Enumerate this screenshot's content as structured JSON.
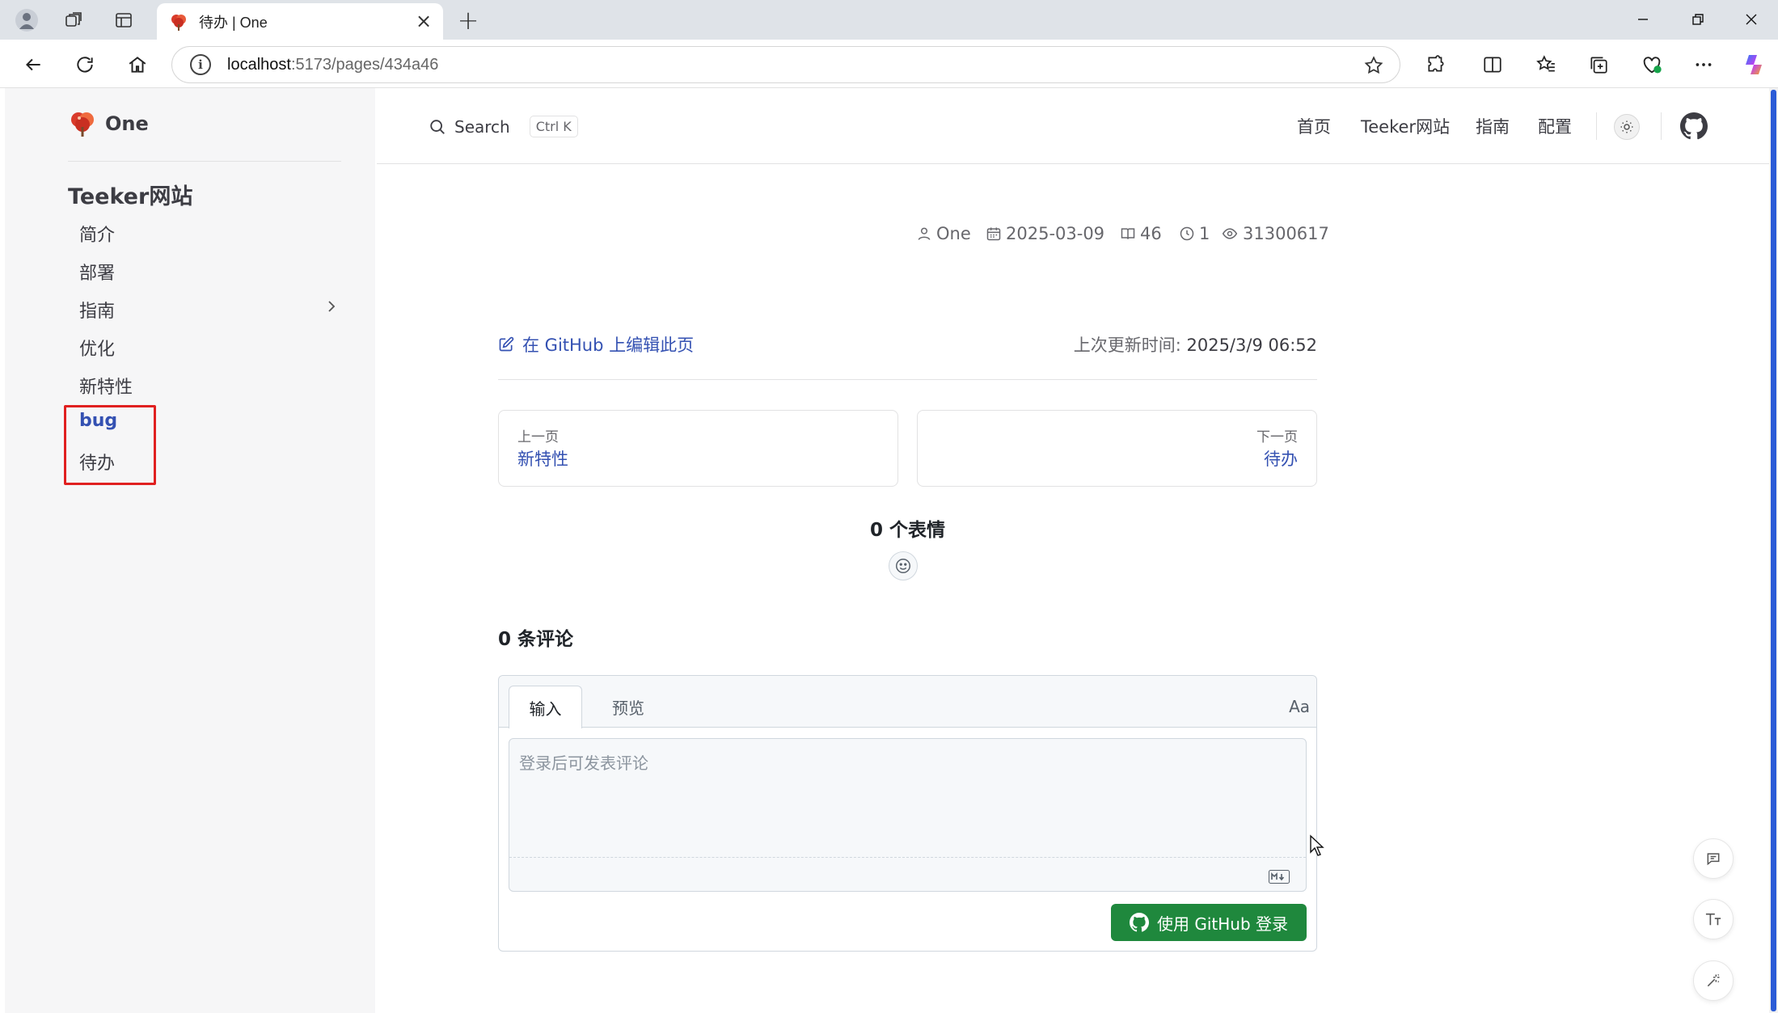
{
  "browser": {
    "tab_title": "待办 | One",
    "url_host": "localhost",
    "url_rest": ":5173/pages/434a46"
  },
  "site": {
    "brand": "One",
    "search_label": "Search",
    "search_shortcut": "Ctrl K",
    "nav": [
      "首页",
      "Teeker网站",
      "指南",
      "配置"
    ]
  },
  "sidebar": {
    "section_title": "Teeker网站",
    "items": [
      {
        "label": "简介"
      },
      {
        "label": "部署"
      },
      {
        "label": "指南"
      },
      {
        "label": "优化"
      },
      {
        "label": "新特性"
      },
      {
        "label": "bug"
      },
      {
        "label": "待办"
      }
    ]
  },
  "meta": {
    "author": "One",
    "date": "2025-03-09",
    "words": "46",
    "minutes": "1",
    "views": "31300617"
  },
  "footer": {
    "edit_link": "在 GitHub 上编辑此页",
    "updated_label": "上次更新时间:",
    "updated_value": "2025/3/9 06:52"
  },
  "pager": {
    "prev_desc": "上一页",
    "prev_title": "新特性",
    "next_desc": "下一页",
    "next_title": "待办"
  },
  "giscus": {
    "reactions": "0 个表情",
    "comments": "0 条评论",
    "tab_write": "输入",
    "tab_preview": "预览",
    "format": "Aa",
    "placeholder": "登录后可发表评论",
    "login_button": "使用 GitHub 登录"
  },
  "colors": {
    "brand": "#3451b2",
    "highlight": "#e02020",
    "login": "#1f883d"
  }
}
